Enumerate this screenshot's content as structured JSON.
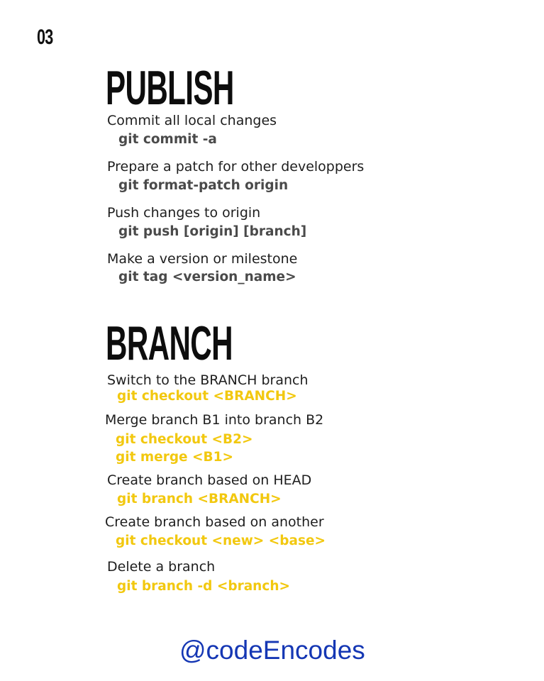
{
  "page_number": "03",
  "publish": {
    "title": "PUBLISH",
    "items": [
      {
        "desc": "Commit all local changes",
        "cmds": [
          "git commit -a"
        ]
      },
      {
        "desc": "Prepare a patch for other developpers",
        "cmds": [
          "git format-patch origin"
        ]
      },
      {
        "desc": "Push changes to origin",
        "cmds": [
          "git push [origin] [branch]"
        ]
      },
      {
        "desc": "Make a version or milestone",
        "cmds": [
          "git tag <version_name>"
        ]
      }
    ]
  },
  "branch": {
    "title": "BRANCH",
    "items": [
      {
        "desc": "Switch to the BRANCH branch",
        "cmds": [
          "git checkout <BRANCH>"
        ]
      },
      {
        "desc": "Merge branch B1 into branch B2",
        "cmds": [
          "git checkout <B2>",
          "git merge <B1>"
        ]
      },
      {
        "desc": "Create branch based on HEAD",
        "cmds": [
          "git branch <BRANCH>"
        ]
      },
      {
        "desc": "Create branch based on another",
        "cmds": [
          "git checkout <new> <base>"
        ]
      },
      {
        "desc": "Delete a branch",
        "cmds": [
          "git branch -d <branch>"
        ]
      }
    ]
  },
  "footer": {
    "handle": "@codeEncodes"
  },
  "colors": {
    "publish_command": "#4a4a4a",
    "branch_command": "#f2c80f",
    "handle": "#1537b4"
  }
}
